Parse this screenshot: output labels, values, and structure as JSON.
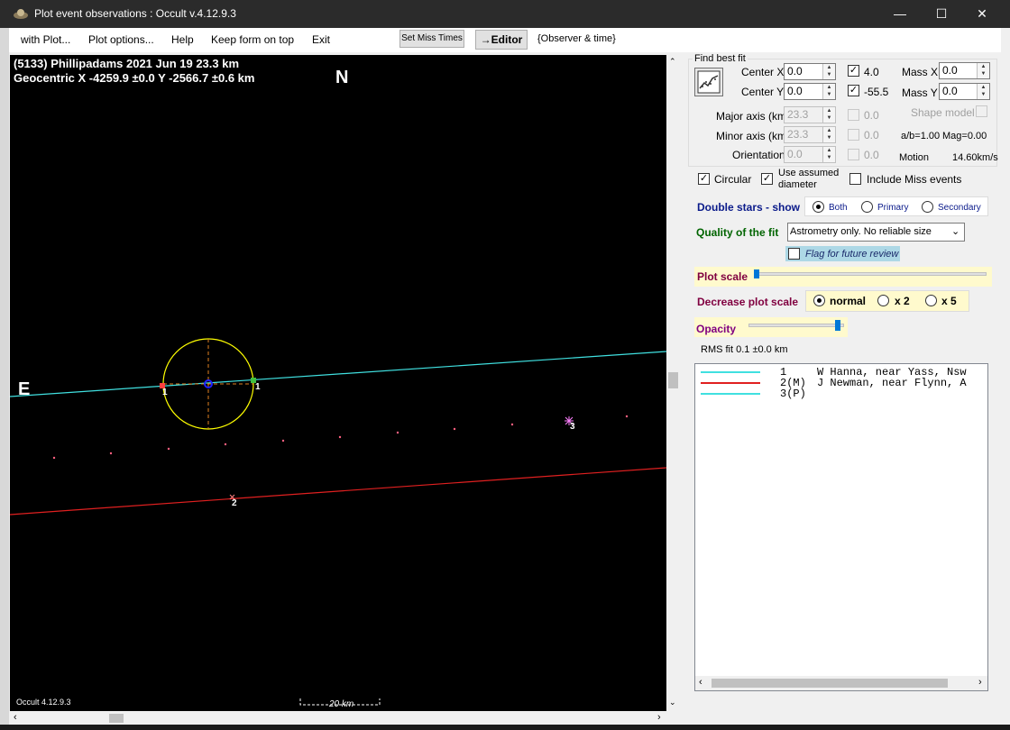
{
  "window": {
    "title": "Plot event observations : Occult v.4.12.9.3",
    "minimize": "—",
    "maximize": "☐",
    "close": "✕"
  },
  "menu": {
    "items": [
      "with Plot...",
      "Plot options...",
      "Help",
      "Keep form on top",
      "Exit"
    ],
    "set_miss_times": "Set Miss Times",
    "editor": "→Editor",
    "observer_time": "{Observer & time}"
  },
  "plot": {
    "header_line1": "(5133) Phillipadams  2021 Jun 19   23.3 km",
    "header_line2": "Geocentric  X  -4259.9 ±0.0  Y -2566.7 ±0.6 km",
    "north_label": "N",
    "east_label": "E",
    "version_label": "Occult 4.12.9.3",
    "scale_label": "20 km",
    "chord_labels": [
      "1",
      "1",
      "2",
      "3"
    ],
    "colors": {
      "background": "#000000",
      "chord1": "#40e0e0",
      "chord2": "#e02020",
      "asteroid_outline": "#ffff00",
      "center": "#0000ff"
    }
  },
  "panel": {
    "find_best_fit": "Find best fit",
    "center_x_label": "Center X",
    "center_x": "0.0",
    "center_y_label": "Center Y",
    "center_y": "0.0",
    "fit_x_value": "4.0",
    "fit_y_value": "-55.5",
    "mass_x_label": "Mass X",
    "mass_x": "0.0",
    "mass_y_label": "Mass Y",
    "mass_y": "0.0",
    "major_axis_label": "Major axis (km)",
    "major_axis": "23.3",
    "minor_axis_label": "Minor axis (km)",
    "minor_axis": "23.3",
    "orientation_label": "Orientation",
    "orientation": "0.0",
    "zero_a": "0.0",
    "zero_b": "0.0",
    "zero_c": "0.0",
    "shape_model": "Shape model",
    "ab_ratio": "a/b=1.00",
    "mag": "Mag=0.00",
    "motion_label": "Motion",
    "motion_value": "14.60km/s",
    "circular": "Circular",
    "use_assumed": "Use assumed",
    "diameter": "diameter",
    "include_miss": "Include Miss events",
    "double_stars": "Double stars - show",
    "both": "Both",
    "primary": "Primary",
    "secondary": "Secondary",
    "quality_label": "Quality of the fit",
    "quality_value": "Astrometry only. No reliable size",
    "flag_review": "Flag for future review",
    "plot_scale": "Plot scale",
    "decrease_plot_scale": "Decrease plot scale",
    "normal": "normal",
    "x2": "x 2",
    "x5": "x 5",
    "opacity": "Opacity",
    "rms_fit": "RMS fit 0.1 ±0.0 km"
  },
  "legend": {
    "rows": [
      {
        "id": "1   ",
        "text": "W Hanna, near Yass, Nsw",
        "color": "#40e0e0"
      },
      {
        "id": "2(M)",
        "text": "J Newman, near Flynn, A",
        "color": "#e02020"
      },
      {
        "id": "3(P)",
        "text": "",
        "color": "#40e0e0"
      }
    ]
  }
}
